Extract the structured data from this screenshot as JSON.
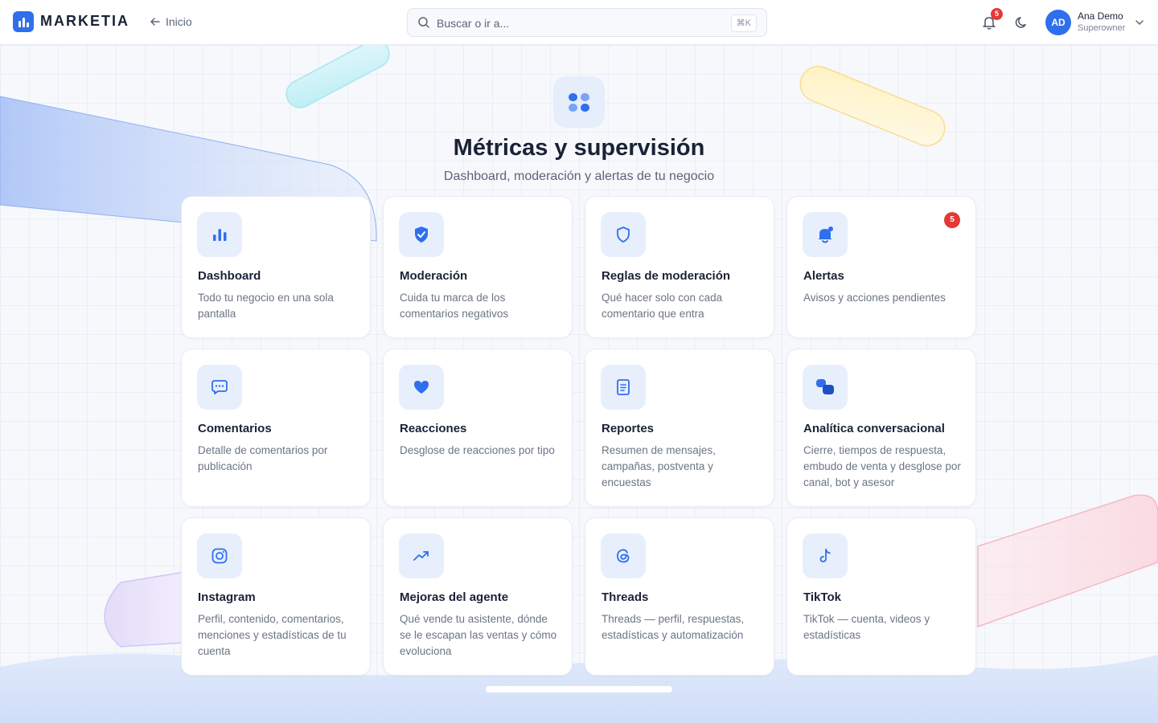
{
  "brand": {
    "name": "MARKETIA",
    "accent": "#2f6fed"
  },
  "nav": {
    "back_label": "Inicio"
  },
  "search": {
    "placeholder": "Buscar o ir a...",
    "shortcut": "⌘K"
  },
  "notifications": {
    "count": "5"
  },
  "user": {
    "initials": "AD",
    "name": "Ana Demo",
    "role": "Superowner"
  },
  "hero": {
    "icon": "grid-icon",
    "title": "Métricas y supervisión",
    "subtitle": "Dashboard, moderación y alertas de tu negocio"
  },
  "cards": [
    {
      "icon": "bar-chart-icon",
      "title": "Dashboard",
      "desc": "Todo tu negocio en una sola pantalla"
    },
    {
      "icon": "shield-check-icon",
      "title": "Moderación",
      "desc": "Cuida tu marca de los comentarios negativos"
    },
    {
      "icon": "shield-outline-icon",
      "title": "Reglas de moderación",
      "desc": "Qué hacer solo con cada comentario que entra"
    },
    {
      "icon": "bell-alert-icon",
      "title": "Alertas",
      "desc": "Avisos y acciones pendientes",
      "badge": "5"
    },
    {
      "icon": "chat-bubble-icon",
      "title": "Comentarios",
      "desc": "Detalle de comentarios por publicación"
    },
    {
      "icon": "heart-icon",
      "title": "Reacciones",
      "desc": "Desglose de reacciones por tipo"
    },
    {
      "icon": "document-icon",
      "title": "Reportes",
      "desc": "Resumen de mensajes, campañas, postventa y encuestas"
    },
    {
      "icon": "conversation-icon",
      "title": "Analítica conversacional",
      "desc": "Cierre, tiempos de respuesta, embudo de venta y desglose por canal, bot y asesor"
    },
    {
      "icon": "instagram-icon",
      "title": "Instagram",
      "desc": "Perfil, contenido, comentarios, menciones y estadísticas de tu cuenta"
    },
    {
      "icon": "trending-up-icon",
      "title": "Mejoras del agente",
      "desc": "Qué vende tu asistente, dónde se le escapan las ventas y cómo evoluciona"
    },
    {
      "icon": "threads-icon",
      "title": "Threads",
      "desc": "Threads — perfil, respuestas, estadísticas y automatización"
    },
    {
      "icon": "tiktok-icon",
      "title": "TikTok",
      "desc": "TikTok — cuenta, videos y estadísticas"
    }
  ]
}
